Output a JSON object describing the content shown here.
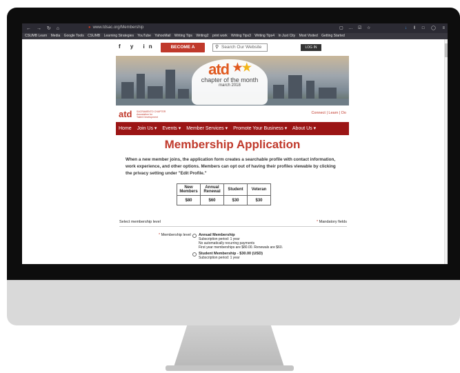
{
  "browser": {
    "url": "www.tdsac.org/Membership",
    "bookmarks": [
      "CSUMB Learn",
      "Media",
      "Google Tools",
      "CSUMB",
      "Learning Strategies",
      "YouTube",
      "YahooMail",
      "Writing Tips",
      "Writing2",
      "print work",
      "Writing Tips3",
      "Writing Tips4",
      "In Just City",
      "Most Visited",
      "Getting Started"
    ]
  },
  "site": {
    "social": "f  y  in  ▶",
    "become_member": "BECOME A MEMBER",
    "search_placeholder": "Search Our Website",
    "login": "LOG IN",
    "banner_logo": "atd",
    "banner_line1": "chapter of the month",
    "banner_line2": "march 2018",
    "chapter_logo": "atd",
    "chapter_name": "SACRAMENTO CHAPTER\nAssociation for\nTalent Development",
    "connect_links": "Connect | Learn | Do",
    "nav": [
      "Home",
      "Join Us ▾",
      "Events ▾",
      "Member Services ▾",
      "Promote Your Business ▾",
      "About Us ▾"
    ]
  },
  "content": {
    "title": "Membership Application",
    "intro": "When a new member joins, the application form creates a searchable profile with contact information, work experience, and other options. Members can opt out of having their profiles viewable by clicking the privacy setting under \"Edit Profile.\"",
    "fee_headers": [
      "New Members",
      "Annual Renewal",
      "Student",
      "Veteran"
    ],
    "fee_values": [
      "$80",
      "$60",
      "$30",
      "$30"
    ],
    "select_level": "Select membership level",
    "mandatory": "Mandatory fields",
    "membership_label": "Membership level",
    "options": [
      {
        "title": "Annual Membership",
        "lines": [
          "Subscription period: 1 year",
          "No automatically recurring payments",
          "First year memberships are $80.00. Renewals are $60."
        ]
      },
      {
        "title": "Student Membership - $30.00 (USD)",
        "lines": [
          "Subscription period: 1 year"
        ]
      }
    ]
  }
}
